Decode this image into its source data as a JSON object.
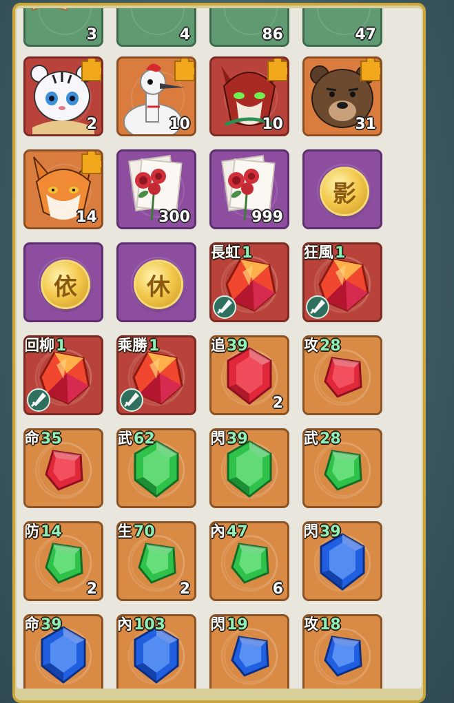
{
  "inventory": {
    "tiles": [
      {
        "id": "t1",
        "bg": "green",
        "kind": "item",
        "icon": "scroll-fabric-icon",
        "qty": "3"
      },
      {
        "id": "t2",
        "bg": "green",
        "kind": "item",
        "icon": "cloth-bundle-icon",
        "qty": "4"
      },
      {
        "id": "t3",
        "bg": "green",
        "kind": "item",
        "icon": "leather-roll-icon",
        "qty": "86"
      },
      {
        "id": "t4",
        "bg": "green",
        "kind": "item",
        "icon": "rope-coil-icon",
        "qty": "47"
      },
      {
        "id": "t5",
        "bg": "redbg",
        "kind": "portrait",
        "icon": "white-tiger-portrait",
        "qty": "2",
        "puzzle": true
      },
      {
        "id": "t6",
        "bg": "portrait-orange",
        "kind": "portrait",
        "icon": "crane-portrait",
        "qty": "10",
        "puzzle": true
      },
      {
        "id": "t7",
        "bg": "redbg",
        "kind": "portrait",
        "icon": "red-wolf-portrait",
        "qty": "10",
        "puzzle": true
      },
      {
        "id": "t8",
        "bg": "portrait-orange",
        "kind": "portrait",
        "icon": "bear-portrait",
        "qty": "31",
        "puzzle": true
      },
      {
        "id": "t9",
        "bg": "portrait-orange",
        "kind": "portrait",
        "icon": "fox-portrait",
        "qty": "14",
        "puzzle": true
      },
      {
        "id": "t10",
        "bg": "purple",
        "kind": "item",
        "icon": "rose-letter-icon",
        "qty": "300"
      },
      {
        "id": "t11",
        "bg": "purple",
        "kind": "item",
        "icon": "rose-letter-icon",
        "qty": "999"
      },
      {
        "id": "t12",
        "bg": "purple",
        "kind": "coin",
        "glyph": "影",
        "qty": ""
      },
      {
        "id": "t13",
        "bg": "purple",
        "kind": "coin",
        "glyph": "依",
        "qty": ""
      },
      {
        "id": "t14",
        "bg": "purple",
        "kind": "coin",
        "glyph": "休",
        "qty": ""
      },
      {
        "id": "t15",
        "bg": "redbg",
        "kind": "gem",
        "gem": "red-fire",
        "label_key": "長虹",
        "label_val": "1",
        "sword": true,
        "qty": ""
      },
      {
        "id": "t16",
        "bg": "redbg",
        "kind": "gem",
        "gem": "red-fire",
        "label_key": "狂風",
        "label_val": "1",
        "sword": true,
        "qty": ""
      },
      {
        "id": "t17",
        "bg": "redbg",
        "kind": "gem",
        "gem": "red-fire",
        "label_key": "回柳",
        "label_val": "1",
        "sword": true,
        "qty": ""
      },
      {
        "id": "t18",
        "bg": "redbg",
        "kind": "gem",
        "gem": "red-fire",
        "label_key": "乘勝",
        "label_val": "1",
        "sword": true,
        "qty": ""
      },
      {
        "id": "t19",
        "bg": "orange",
        "kind": "gem",
        "gem": "red-large",
        "label_key": "追",
        "label_val": "39",
        "qty": "2"
      },
      {
        "id": "t20",
        "bg": "orange",
        "kind": "gem",
        "gem": "red-small",
        "label_key": "攻",
        "label_val": "28",
        "qty": ""
      },
      {
        "id": "t21",
        "bg": "orange",
        "kind": "gem",
        "gem": "red-small",
        "label_key": "命",
        "label_val": "35",
        "qty": ""
      },
      {
        "id": "t22",
        "bg": "orange",
        "kind": "gem",
        "gem": "green-large",
        "label_key": "武",
        "label_val": "62",
        "qty": ""
      },
      {
        "id": "t23",
        "bg": "orange",
        "kind": "gem",
        "gem": "green-large",
        "label_key": "閃",
        "label_val": "39",
        "qty": ""
      },
      {
        "id": "t24",
        "bg": "orange",
        "kind": "gem",
        "gem": "green-small",
        "label_key": "武",
        "label_val": "28",
        "qty": ""
      },
      {
        "id": "t25",
        "bg": "orange",
        "kind": "gem",
        "gem": "green-small",
        "label_key": "防",
        "label_val": "14",
        "qty": "2"
      },
      {
        "id": "t26",
        "bg": "orange",
        "kind": "gem",
        "gem": "green-small",
        "label_key": "生",
        "label_val": "70",
        "qty": "2"
      },
      {
        "id": "t27",
        "bg": "orange",
        "kind": "gem",
        "gem": "green-small",
        "label_key": "內",
        "label_val": "47",
        "qty": "6"
      },
      {
        "id": "t28",
        "bg": "orange",
        "kind": "gem",
        "gem": "blue-large",
        "label_key": "閃",
        "label_val": "39",
        "qty": ""
      },
      {
        "id": "t29",
        "bg": "orange",
        "kind": "gem",
        "gem": "blue-large",
        "label_key": "命",
        "label_val": "39",
        "qty": ""
      },
      {
        "id": "t30",
        "bg": "orange",
        "kind": "gem",
        "gem": "blue-large",
        "label_key": "內",
        "label_val": "103",
        "qty": ""
      },
      {
        "id": "t31",
        "bg": "orange",
        "kind": "gem",
        "gem": "blue-small",
        "label_key": "閃",
        "label_val": "19",
        "qty": ""
      },
      {
        "id": "t32",
        "bg": "orange",
        "kind": "gem",
        "gem": "blue-small",
        "label_key": "攻",
        "label_val": "18",
        "qty": ""
      }
    ]
  },
  "colors": {
    "frame_gold": "#c9a63e",
    "panel_bg": "#e9e6dd",
    "label_green": "#8ff0b8",
    "gem_red": "#e0283a",
    "gem_green": "#2fc24a",
    "gem_blue": "#1f5fe0"
  }
}
